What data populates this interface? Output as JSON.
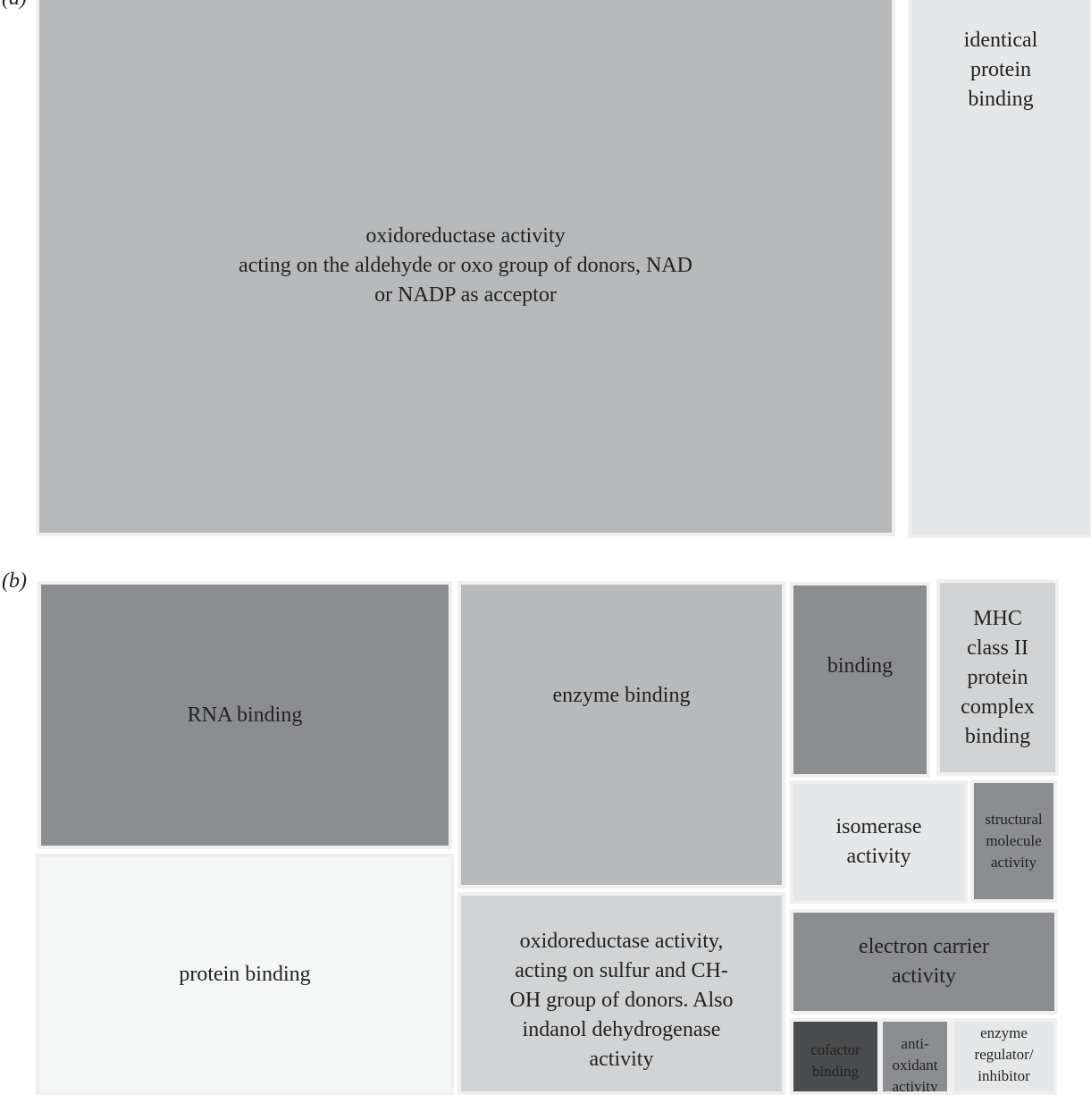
{
  "panel_a_letter": "(a)",
  "panel_b_letter": "(b)",
  "chart_data": [
    {
      "type": "treemap",
      "panel": "a",
      "tiles": [
        {
          "label": "oxidoreductase activity\nacting on the aldehyde or oxo group of donors, NAD\nor NADP as acceptor",
          "color": "#b8b9bb"
        },
        {
          "label": "identical\nprotein\nbinding",
          "color": "#e6e7e8"
        }
      ]
    },
    {
      "type": "treemap",
      "panel": "b",
      "tiles": [
        {
          "label": "RNA binding",
          "color": "#8c8d90"
        },
        {
          "label": "protein binding",
          "color": "#f5f6f6"
        },
        {
          "label": "enzyme binding",
          "color": "#b8b9bb"
        },
        {
          "label": "oxidoreductase activity,\nacting on sulfur and CH-\nOH group of donors. Also\nindanol dehydrogenase\nactivity",
          "color": "#d2d3d4"
        },
        {
          "label": "binding",
          "color": "#8c8d90"
        },
        {
          "label": "MHC\nclass II\nprotein\ncomplex\nbinding",
          "color": "#d2d3d4"
        },
        {
          "label": "isomerase\nactivity",
          "color": "#e6e7e8"
        },
        {
          "label": "structural\nmolecule\nactivity",
          "color": "#8c8d90"
        },
        {
          "label": "electron carrier\nactivity",
          "color": "#8c8d90"
        },
        {
          "label": "cofactor\nbinding",
          "color": "#4a4b4d"
        },
        {
          "label": "anti-\noxidant\nactivity",
          "color": "#8c8d90"
        },
        {
          "label": "enzyme\nregulator/\ninhibitor",
          "color": "#e6e7e8"
        }
      ]
    }
  ]
}
